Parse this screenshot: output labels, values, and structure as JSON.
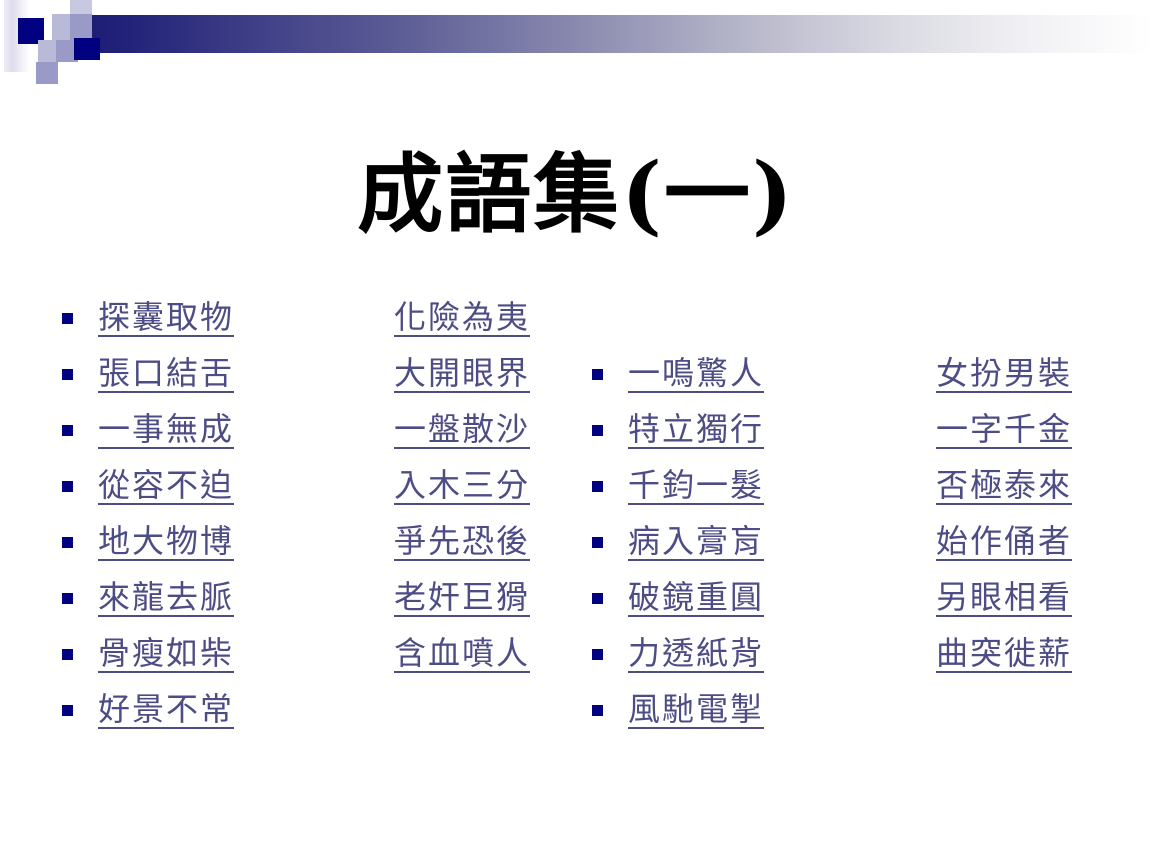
{
  "slide": {
    "title": "成語集(一)",
    "background_color": "#ffffff",
    "title_color": "#000000",
    "idiom_color": "#4d4d85",
    "bullet_color": "#000080",
    "accent_navy": "#000080",
    "accent_lavender": "#9a9ac8"
  },
  "columns": [
    {
      "name": "column-1",
      "bulleted": true,
      "items": [
        {
          "text": "探囊取物",
          "trailing_space": false
        },
        {
          "text": "張口結舌",
          "trailing_space": false
        },
        {
          "text": "一事無成",
          "trailing_space": true
        },
        {
          "text": "從容不迫",
          "trailing_space": false
        },
        {
          "text": "地大物博",
          "trailing_space": false
        },
        {
          "text": "來龍去脈",
          "trailing_space": false
        },
        {
          "text": "骨瘦如柴",
          "trailing_space": false
        },
        {
          "text": "好景不常",
          "trailing_space": false
        }
      ]
    },
    {
      "name": "column-2",
      "bulleted": false,
      "items": [
        {
          "text": "化險為夷",
          "trailing_space": false
        },
        {
          "text": "大開眼界",
          "trailing_space": false
        },
        {
          "text": "一盤散沙",
          "trailing_space": false
        },
        {
          "text": "入木三分",
          "trailing_space": true
        },
        {
          "text": "爭先恐後",
          "trailing_space": true
        },
        {
          "text": "老奸巨猾",
          "trailing_space": false
        },
        {
          "text": "含血噴人",
          "trailing_space": true
        }
      ]
    },
    {
      "name": "column-3",
      "bulleted": true,
      "items": [
        {
          "text": "一鳴驚人",
          "trailing_space": true
        },
        {
          "text": "特立獨行",
          "trailing_space": false
        },
        {
          "text": "千鈞一髮",
          "trailing_space": false
        },
        {
          "text": "病入膏肓",
          "trailing_space": false
        },
        {
          "text": "破鏡重圓",
          "trailing_space": false
        },
        {
          "text": "力透紙背",
          "trailing_space": false
        },
        {
          "text": "風馳電掣",
          "trailing_space": false
        }
      ]
    },
    {
      "name": "column-4",
      "bulleted": false,
      "items": [
        {
          "text": "女扮男裝",
          "trailing_space": false
        },
        {
          "text": "一字千金",
          "trailing_space": false
        },
        {
          "text": "否極泰來",
          "trailing_space": false
        },
        {
          "text": "始作俑者",
          "trailing_space": false
        },
        {
          "text": "另眼相看",
          "trailing_space": false
        },
        {
          "text": "曲突徙薪",
          "trailing_space": false
        }
      ]
    }
  ]
}
